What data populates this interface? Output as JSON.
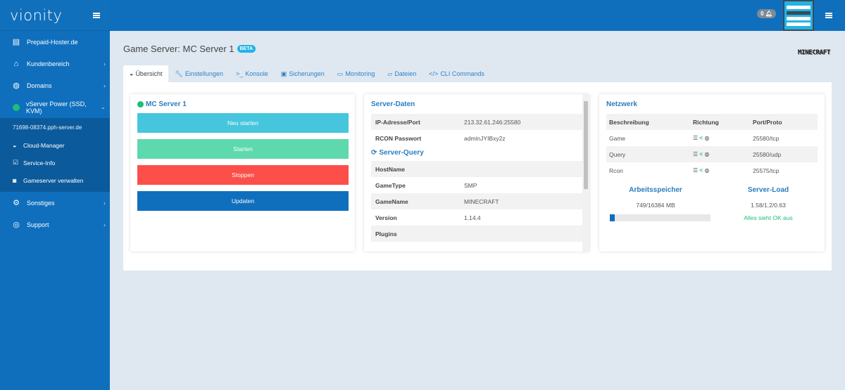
{
  "brand": "vionity",
  "sidebar": {
    "items": [
      {
        "label": "Prepaid-Hoster.de",
        "icon": "server-icon"
      },
      {
        "label": "Kundenbereich",
        "icon": "home-icon"
      },
      {
        "label": "Domains",
        "icon": "globe-icon"
      },
      {
        "label": "vServer Power (SSD, KVM)",
        "icon": "status-dot-icon"
      }
    ],
    "host": "71698-08374.pph-server.de",
    "sub_items": [
      {
        "label": "Cloud-Manager",
        "icon": "dashboard-icon"
      },
      {
        "label": "Service-Info",
        "icon": "checkbox-icon"
      },
      {
        "label": "Gameserver verwalten",
        "icon": "gamepad-icon"
      }
    ],
    "bottom_items": [
      {
        "label": "Sonstiges",
        "icon": "cogs-icon"
      },
      {
        "label": "Support",
        "icon": "lifebuoy-icon"
      }
    ]
  },
  "topbar": {
    "notification_count": "0"
  },
  "page": {
    "title": "Game Server: MC Server 1",
    "badge": "BETA",
    "logo_text": "MINECRAFT"
  },
  "tabs": [
    {
      "label": "Übersicht",
      "icon": "dashboard-icon"
    },
    {
      "label": "Einstellungen",
      "icon": "wrench-icon"
    },
    {
      "label": "Konsole",
      "icon": "terminal-icon"
    },
    {
      "label": "Sicherungen",
      "icon": "save-icon"
    },
    {
      "label": "Monitoring",
      "icon": "monitor-icon"
    },
    {
      "label": "Dateien",
      "icon": "folder-icon"
    },
    {
      "label": "CLI Commands",
      "icon": "code-icon"
    }
  ],
  "server_card": {
    "title": "MC Server 1",
    "status_color": "#1dbf73",
    "buttons": [
      {
        "label": "Neu starten",
        "color": "#46c6dc"
      },
      {
        "label": "Starten",
        "color": "#5dd9ad"
      },
      {
        "label": "Stoppen",
        "color": "#fc4f4a"
      },
      {
        "label": "Updaten",
        "color": "#0f6fbd"
      }
    ]
  },
  "server_data": {
    "title": "Server-Daten",
    "rows": [
      {
        "key": "IP-Adresse/Port",
        "value": "213.32.61.246:25580"
      },
      {
        "key": "RCON Passwort",
        "value": "adminJYIBxy2z"
      }
    ],
    "query_title": "Server-Query",
    "query_rows": [
      {
        "key": "HostName",
        "value": ""
      },
      {
        "key": "GameType",
        "value": "SMP"
      },
      {
        "key": "GameName",
        "value": "MINECRAFT"
      },
      {
        "key": "Version",
        "value": "1.14.4"
      },
      {
        "key": "Plugins",
        "value": ""
      }
    ]
  },
  "network": {
    "title": "Netzwerk",
    "headers": [
      "Beschreibung",
      "Richtung",
      "Port/Proto"
    ],
    "rows": [
      {
        "desc": "Game",
        "port": "25580/tcp"
      },
      {
        "desc": "Query",
        "port": "25580/udp"
      },
      {
        "desc": "Rcon",
        "port": "25575/tcp"
      }
    ],
    "memory": {
      "title": "Arbeitsspeicher",
      "value": "749/16384 MB",
      "fraction": 0.046
    },
    "load": {
      "title": "Server-Load",
      "value": "1.58/1.2/0.63",
      "status": "Alles sieht OK aus"
    }
  }
}
